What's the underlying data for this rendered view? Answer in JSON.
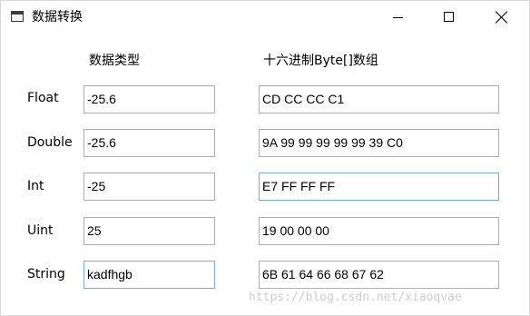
{
  "window": {
    "title": "数据转换",
    "icon": "app-window-icon",
    "controls": {
      "minimize_icon": "minimize-icon",
      "maximize_icon": "maximize-icon",
      "close_icon": "close-icon"
    }
  },
  "headers": {
    "type": "数据类型",
    "bytes": "十六进制Byte[]数组"
  },
  "rows": [
    {
      "label": "Float",
      "value": "-25.6",
      "bytes": "CD CC CC C1"
    },
    {
      "label": "Double",
      "value": "-25.6",
      "bytes": "9A 99 99 99 99 99 39 C0"
    },
    {
      "label": "Int",
      "value": "-25",
      "bytes": "E7 FF FF FF"
    },
    {
      "label": "Uint",
      "value": "25",
      "bytes": "19 00 00 00"
    },
    {
      "label": "String",
      "value": "kadfhgb",
      "bytes": "6B 61 64 66 68 67 62"
    }
  ],
  "watermark": "https://blog.csdn.net/xiaoqvae"
}
